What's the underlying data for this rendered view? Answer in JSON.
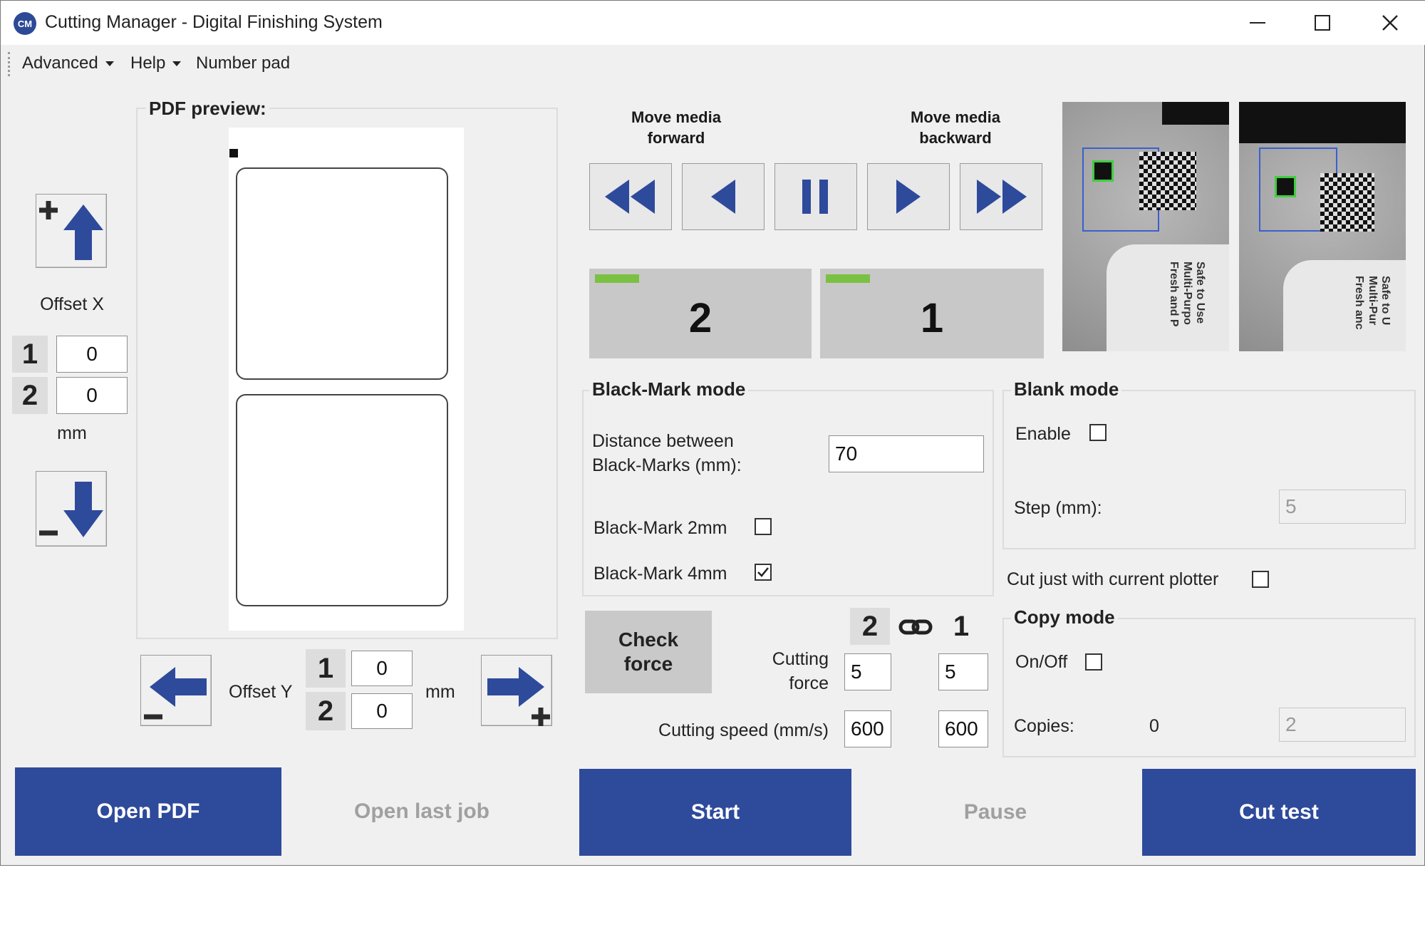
{
  "window": {
    "title": "Cutting Manager - Digital Finishing System",
    "app_icon_text": "CM"
  },
  "menu": [
    {
      "label": "Advanced",
      "has_dropdown": true
    },
    {
      "label": "Help",
      "has_dropdown": true
    },
    {
      "label": "Number pad",
      "has_dropdown": false
    }
  ],
  "pdf_preview": {
    "label": "PDF preview:"
  },
  "offset_x": {
    "label": "Offset X",
    "row1_badge": "1",
    "row1_value": "0",
    "row2_badge": "2",
    "row2_value": "0",
    "unit": "mm"
  },
  "offset_y": {
    "label": "Offset Y",
    "row1_badge": "1",
    "row1_value": "0",
    "row2_badge": "2",
    "row2_value": "0",
    "unit": "mm"
  },
  "media": {
    "forward_label": "Move media\nforward",
    "backward_label": "Move media\nbackward"
  },
  "counters": [
    {
      "value": "2"
    },
    {
      "value": "1"
    }
  ],
  "camera": {
    "left_text": "Safe to Use\nMulti-Purpo\nFresh and P",
    "right_text": "Safe to U\nMulti-Pur\nFresh anc"
  },
  "black_mark": {
    "title": "Black-Mark mode",
    "distance_label_1": "Distance between",
    "distance_label_2": "Black-Marks (mm):",
    "distance_value": "70",
    "mark_2mm_label": "Black-Mark 2mm",
    "mark_2mm_checked": false,
    "mark_4mm_label": "Black-Mark 4mm",
    "mark_4mm_checked": true
  },
  "blank_mode": {
    "title": "Blank mode",
    "enable_label": "Enable",
    "enable_checked": false,
    "step_label": "Step (mm):",
    "step_value": "5"
  },
  "cut_plotter": {
    "label": "Cut just with current plotter",
    "checked": false
  },
  "copy_mode": {
    "title": "Copy mode",
    "onoff_label": "On/Off",
    "onoff_checked": false,
    "copies_label": "Copies:",
    "copies_count": "0",
    "copies_value": "2"
  },
  "force": {
    "check_force_1": "Check",
    "check_force_2": "force",
    "head_left": "2",
    "head_right": "1",
    "cutting_force_1": "Cutting",
    "cutting_force_2": "force",
    "force_left": "5",
    "force_right": "5",
    "speed_label": "Cutting speed (mm/s)",
    "speed_left": "600",
    "speed_right": "600"
  },
  "buttons": {
    "open_pdf": "Open PDF",
    "open_last_job": "Open last job",
    "start": "Start",
    "pause": "Pause",
    "cut_test": "Cut test"
  },
  "colors": {
    "primary_blue": "#2e4a9b",
    "indicator_green": "#7ac143",
    "window_bg": "#f0f0f0"
  }
}
